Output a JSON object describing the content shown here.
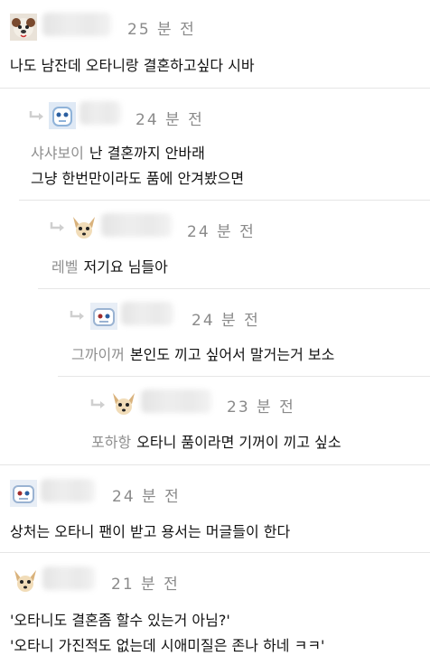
{
  "comments": [
    {
      "avatar": "poodle-avatar",
      "time": "25 분 전",
      "lines": [
        {
          "mention": "",
          "text": "나도 남잔데 오타니랑 결혼하고싶다 시바"
        }
      ]
    },
    {
      "avatar": "blue-robot-avatar",
      "time": "24 분 전",
      "lines": [
        {
          "mention": "샤샤보이",
          "text": "난 결혼까지 안바래"
        },
        {
          "mention": "",
          "text": "그냥 한번만이라도 품에 안겨봤으면"
        }
      ]
    },
    {
      "avatar": "chihuahua-avatar",
      "time": "24 분 전",
      "lines": [
        {
          "mention": "레벨",
          "text": "저기요 님들아"
        }
      ]
    },
    {
      "avatar": "white-robot-avatar",
      "time": "24 분 전",
      "lines": [
        {
          "mention": "그까이꺼",
          "text": "본인도 끼고 싶어서 말거는거 보소"
        }
      ]
    },
    {
      "avatar": "chihuahua-avatar",
      "time": "23 분 전",
      "lines": [
        {
          "mention": "포하항",
          "text": "오타니 품이라면 기꺼이 끼고 싶소"
        }
      ]
    },
    {
      "avatar": "white-robot-avatar",
      "time": "24 분 전",
      "lines": [
        {
          "mention": "",
          "text": "상처는 오타니 팬이 받고 용서는 머글들이 한다"
        }
      ]
    },
    {
      "avatar": "chihuahua-avatar",
      "time": "21 분 전",
      "lines": [
        {
          "mention": "",
          "text": "'오타니도 결혼좀 할수 있는거 아님?'"
        },
        {
          "mention": "",
          "text": "'오타니 가진적도 없는데 시애미질은 존나 하네 ㅋㅋ'"
        }
      ]
    }
  ]
}
